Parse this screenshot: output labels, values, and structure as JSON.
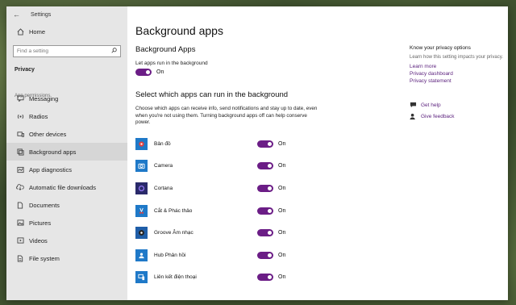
{
  "window": {
    "title": "Settings"
  },
  "sidebar": {
    "home_label": "Home",
    "search_placeholder": "Find a setting",
    "section_label": "Privacy",
    "subsection_label": "App permissions",
    "items": [
      {
        "label": "Messaging",
        "icon": "message-icon"
      },
      {
        "label": "Radios",
        "icon": "radio-icon"
      },
      {
        "label": "Other devices",
        "icon": "devices-icon"
      },
      {
        "label": "Background apps",
        "icon": "background-apps-icon"
      },
      {
        "label": "App diagnostics",
        "icon": "diagnostics-icon"
      },
      {
        "label": "Automatic file downloads",
        "icon": "cloud-download-icon"
      },
      {
        "label": "Documents",
        "icon": "document-icon"
      },
      {
        "label": "Pictures",
        "icon": "picture-icon"
      },
      {
        "label": "Videos",
        "icon": "video-icon"
      },
      {
        "label": "File system",
        "icon": "file-system-icon"
      }
    ]
  },
  "main": {
    "page_title": "Background apps",
    "bg_apps_heading": "Background Apps",
    "let_apps_label": "Let apps run in the background",
    "let_apps_state": "On",
    "select_heading": "Select which apps can run in the background",
    "description": "Choose which apps can receive info, send notifications and stay up to date, even when you're not using them. Turning background apps off can help conserve power.",
    "apps": [
      {
        "name": "Bản đồ",
        "state": "On",
        "icon": "maps-icon"
      },
      {
        "name": "Camera",
        "state": "On",
        "icon": "camera-icon"
      },
      {
        "name": "Cortana",
        "state": "On",
        "icon": "cortana-icon"
      },
      {
        "name": "Cắt & Phác thảo",
        "state": "On",
        "icon": "snip-sketch-icon"
      },
      {
        "name": "Groove Âm nhạc",
        "state": "On",
        "icon": "groove-music-icon"
      },
      {
        "name": "Hub Phản hồi",
        "state": "On",
        "icon": "feedback-hub-icon"
      },
      {
        "name": "Liên kết điện thoại",
        "state": "On",
        "icon": "phone-link-icon"
      }
    ]
  },
  "right_col": {
    "title": "Know your privacy options",
    "desc": "Learn how this setting impacts your privacy.",
    "links": [
      "Learn more",
      "Privacy dashboard",
      "Privacy statement"
    ],
    "get_help": "Get help",
    "give_feedback": "Give feedback"
  },
  "colors": {
    "accent": "#6b1d86",
    "link": "#5a1f7c",
    "sidebar_bg": "#e6e6e6",
    "app_icon_bg": "#1f79c8"
  }
}
